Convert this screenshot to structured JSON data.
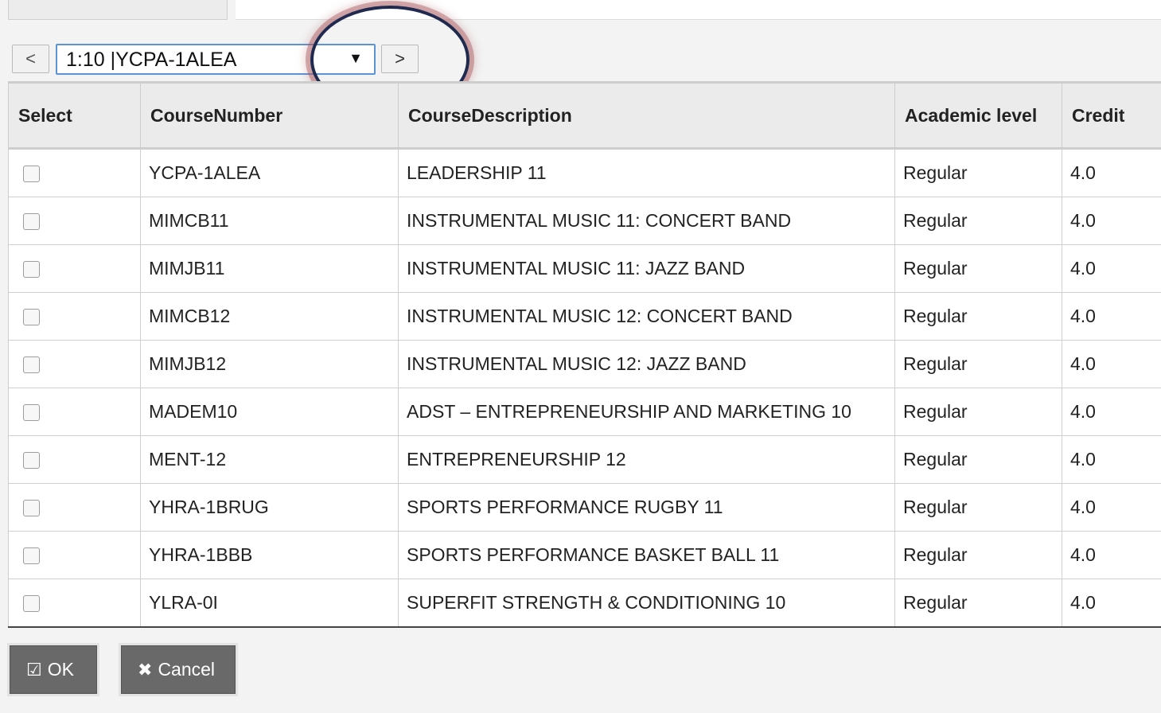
{
  "nav": {
    "prev_label": "<",
    "next_label": ">",
    "selected_page": "1:10 |YCPA-1ALEA",
    "caret": "▼"
  },
  "table": {
    "headers": [
      "Select",
      "CourseNumber",
      "CourseDescription",
      "Academic level",
      "Credit"
    ],
    "rows": [
      {
        "course_number": "YCPA-1ALEA",
        "description": "LEADERSHIP 11",
        "level": "Regular",
        "credit": "4.0"
      },
      {
        "course_number": "MIMCB11",
        "description": "INSTRUMENTAL MUSIC 11: CONCERT BAND",
        "level": "Regular",
        "credit": "4.0"
      },
      {
        "course_number": "MIMJB11",
        "description": "INSTRUMENTAL MUSIC 11: JAZZ BAND",
        "level": "Regular",
        "credit": "4.0"
      },
      {
        "course_number": "MIMCB12",
        "description": "INSTRUMENTAL MUSIC 12: CONCERT BAND",
        "level": "Regular",
        "credit": "4.0"
      },
      {
        "course_number": "MIMJB12",
        "description": "INSTRUMENTAL MUSIC 12: JAZZ BAND",
        "level": "Regular",
        "credit": "4.0"
      },
      {
        "course_number": "MADEM10",
        "description": "ADST – ENTREPRENEURSHIP AND MARKETING 10",
        "level": "Regular",
        "credit": "4.0"
      },
      {
        "course_number": "MENT-12",
        "description": "ENTREPRENEURSHIP 12",
        "level": "Regular",
        "credit": "4.0"
      },
      {
        "course_number": "YHRA-1BRUG",
        "description": "SPORTS PERFORMANCE RUGBY 11",
        "level": "Regular",
        "credit": "4.0"
      },
      {
        "course_number": "YHRA-1BBB",
        "description": "SPORTS PERFORMANCE BASKET BALL 11",
        "level": "Regular",
        "credit": "4.0"
      },
      {
        "course_number": "YLRA-0I",
        "description": "SUPERFIT STRENGTH & CONDITIONING 10",
        "level": "Regular",
        "credit": "4.0"
      }
    ]
  },
  "actions": {
    "ok_label": "OK",
    "ok_icon": "☑",
    "cancel_label": "Cancel",
    "cancel_icon": "✖"
  }
}
